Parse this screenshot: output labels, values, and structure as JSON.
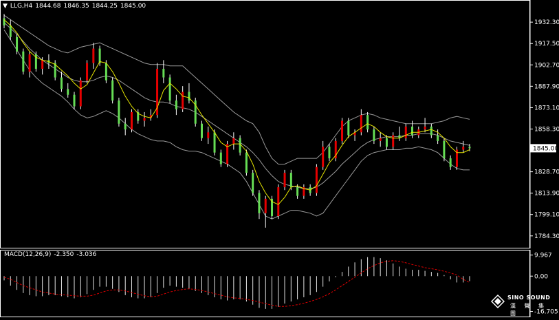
{
  "header": {
    "symbol": "LLG,H4",
    "open": "1844.68",
    "high": "1846.35",
    "low": "1844.25",
    "close": "1845.00"
  },
  "macd_header": {
    "label": "MACD(12,26,9)",
    "main": "-2.350",
    "signal": "-3.036"
  },
  "watermark": {
    "top_text": "SINO SOUND",
    "bottom_text": "漢 聲 集 團"
  },
  "colors": {
    "background": "#000000",
    "up_candle": "#e60000",
    "down_candle": "#66dd55",
    "wick": "#ffffff",
    "bands": "#9a9a9a",
    "moving_average": "#e6e600",
    "macd_histogram": "#e6e6e6",
    "macd_signal": "#dd0000",
    "price_marker_bg": "#ffffff"
  },
  "chart_data": [
    {
      "type": "candlestick",
      "title": "LLG,H4",
      "price_axis": {
        "min": 1778,
        "max": 1940,
        "ticks": [
          "1932.30",
          "1917.50",
          "1902.70",
          "1887.90",
          "1873.10",
          "1858.30",
          "1845.00",
          "1828.70",
          "1813.90",
          "1799.10",
          "1784.30"
        ],
        "current_price": "1845.00"
      },
      "overlays": [
        "Bollinger Bands",
        "Moving Average"
      ],
      "series": [
        {
          "name": "price",
          "candles": [
            [
              1935.0,
              1938.0,
              1928.0,
              1930.0
            ],
            [
              1930.0,
              1934.0,
              1920.0,
              1922.0
            ],
            [
              1922.0,
              1924.0,
              1910.0,
              1912.0
            ],
            [
              1912.0,
              1914.0,
              1896.0,
              1898.0
            ],
            [
              1898.0,
              1912.0,
              1894.0,
              1910.0
            ],
            [
              1910.0,
              1912.0,
              1898.0,
              1900.0
            ],
            [
              1900.0,
              1908.0,
              1896.0,
              1906.0
            ],
            [
              1906.0,
              1910.0,
              1900.0,
              1904.0
            ],
            [
              1904.0,
              1906.0,
              1892.0,
              1894.0
            ],
            [
              1894.0,
              1898.0,
              1884.0,
              1886.0
            ],
            [
              1886.0,
              1890.0,
              1880.0,
              1882.0
            ],
            [
              1882.0,
              1884.0,
              1872.0,
              1874.0
            ],
            [
              1874.0,
              1894.0,
              1872.0,
              1892.0
            ],
            [
              1892.0,
              1906.0,
              1890.0,
              1904.0
            ],
            [
              1904.0,
              1918.0,
              1900.0,
              1914.0
            ],
            [
              1914.0,
              1916.0,
              1902.0,
              1904.0
            ],
            [
              1904.0,
              1906.0,
              1890.0,
              1892.0
            ],
            [
              1892.0,
              1894.0,
              1876.0,
              1878.0
            ],
            [
              1878.0,
              1880.0,
              1860.0,
              1862.0
            ],
            [
              1862.0,
              1866.0,
              1854.0,
              1858.0
            ],
            [
              1858.0,
              1872.0,
              1856.0,
              1870.0
            ],
            [
              1870.0,
              1872.0,
              1862.0,
              1864.0
            ],
            [
              1864.0,
              1870.0,
              1860.0,
              1866.0
            ],
            [
              1866.0,
              1872.0,
              1864.0,
              1868.0
            ],
            [
              1868.0,
              1904.0,
              1866.0,
              1900.0
            ],
            [
              1900.0,
              1906.0,
              1890.0,
              1894.0
            ],
            [
              1894.0,
              1896.0,
              1876.0,
              1878.0
            ],
            [
              1878.0,
              1882.0,
              1868.0,
              1872.0
            ],
            [
              1872.0,
              1888.0,
              1870.0,
              1884.0
            ],
            [
              1884.0,
              1890.0,
              1876.0,
              1878.0
            ],
            [
              1878.0,
              1880.0,
              1860.0,
              1862.0
            ],
            [
              1862.0,
              1864.0,
              1850.0,
              1852.0
            ],
            [
              1852.0,
              1860.0,
              1848.0,
              1856.0
            ],
            [
              1856.0,
              1858.0,
              1840.0,
              1842.0
            ],
            [
              1842.0,
              1844.0,
              1832.0,
              1834.0
            ],
            [
              1834.0,
              1850.0,
              1832.0,
              1848.0
            ],
            [
              1848.0,
              1856.0,
              1844.0,
              1852.0
            ],
            [
              1852.0,
              1854.0,
              1840.0,
              1842.0
            ],
            [
              1842.0,
              1844.0,
              1826.0,
              1828.0
            ],
            [
              1828.0,
              1830.0,
              1812.0,
              1814.0
            ],
            [
              1814.0,
              1816.0,
              1796.0,
              1800.0
            ],
            [
              1800.0,
              1812.0,
              1790.0,
              1810.0
            ],
            [
              1810.0,
              1812.0,
              1796.0,
              1798.0
            ],
            [
              1798.0,
              1820.0,
              1796.0,
              1818.0
            ],
            [
              1818.0,
              1830.0,
              1816.0,
              1828.0
            ],
            [
              1828.0,
              1830.0,
              1816.0,
              1818.0
            ],
            [
              1818.0,
              1820.0,
              1810.0,
              1812.0
            ],
            [
              1812.0,
              1820.0,
              1810.0,
              1818.0
            ],
            [
              1818.0,
              1820.0,
              1812.0,
              1814.0
            ],
            [
              1814.0,
              1834.0,
              1812.0,
              1832.0
            ],
            [
              1832.0,
              1850.0,
              1830.0,
              1846.0
            ],
            [
              1846.0,
              1848.0,
              1836.0,
              1838.0
            ],
            [
              1838.0,
              1852.0,
              1836.0,
              1850.0
            ],
            [
              1850.0,
              1866.0,
              1848.0,
              1864.0
            ],
            [
              1864.0,
              1866.0,
              1852.0,
              1854.0
            ],
            [
              1854.0,
              1858.0,
              1850.0,
              1856.0
            ],
            [
              1856.0,
              1872.0,
              1854.0,
              1868.0
            ],
            [
              1868.0,
              1870.0,
              1856.0,
              1858.0
            ],
            [
              1858.0,
              1860.0,
              1848.0,
              1850.0
            ],
            [
              1850.0,
              1856.0,
              1846.0,
              1852.0
            ],
            [
              1852.0,
              1854.0,
              1844.0,
              1846.0
            ],
            [
              1846.0,
              1856.0,
              1844.0,
              1854.0
            ],
            [
              1854.0,
              1860.0,
              1850.0,
              1852.0
            ],
            [
              1852.0,
              1862.0,
              1850.0,
              1860.0
            ],
            [
              1860.0,
              1864.0,
              1852.0,
              1854.0
            ],
            [
              1854.0,
              1860.0,
              1852.0,
              1858.0
            ],
            [
              1858.0,
              1866.0,
              1856.0,
              1860.0
            ],
            [
              1860.0,
              1862.0,
              1852.0,
              1854.0
            ],
            [
              1854.0,
              1858.0,
              1848.0,
              1850.0
            ],
            [
              1850.0,
              1852.0,
              1836.0,
              1838.0
            ],
            [
              1838.0,
              1840.0,
              1830.0,
              1832.0
            ],
            [
              1832.0,
              1846.0,
              1830.0,
              1844.0
            ],
            [
              1844.0,
              1850.0,
              1842.0,
              1846.0
            ],
            [
              1846.0,
              1848.0,
              1843.0,
              1845.0
            ]
          ],
          "bb_upper": [
            1937.0,
            1934.0,
            1931.0,
            1928.0,
            1925.0,
            1922.0,
            1919.0,
            1916.0,
            1914.0,
            1912.0,
            1911.0,
            1913.0,
            1915.0,
            1916.0,
            1917.0,
            1918.0,
            1916.0,
            1914.0,
            1912.0,
            1910.0,
            1908.0,
            1906.0,
            1904.0,
            1903.0,
            1903.0,
            1903.0,
            1902.0,
            1902.0,
            1902.0,
            1898.0,
            1894.0,
            1890.0,
            1886.0,
            1882.0,
            1878.0,
            1874.0,
            1870.0,
            1867.0,
            1864.0,
            1862.0,
            1856.0,
            1846.0,
            1838.0,
            1834.0,
            1834.0,
            1836.0,
            1838.0,
            1838.0,
            1838.0,
            1838.0,
            1842.0,
            1848.0,
            1854.0,
            1860.0,
            1864.0,
            1866.0,
            1868.0,
            1869.0,
            1868.0,
            1866.0,
            1865.0,
            1864.0,
            1863.0,
            1862.0,
            1862.0,
            1862.0,
            1862.0,
            1862.0,
            1863.0,
            1864.0,
            1866.0,
            1867.0,
            1866.0,
            1865.0
          ],
          "bb_middle": [
            1932.0,
            1928.0,
            1924.0,
            1919.0,
            1914.0,
            1910.0,
            1906.0,
            1903.0,
            1900.0,
            1897.0,
            1894.0,
            1892.0,
            1891.0,
            1891.0,
            1892.0,
            1894.0,
            1895.0,
            1894.0,
            1892.0,
            1889.0,
            1886.0,
            1883.0,
            1880.0,
            1878.0,
            1877.0,
            1877.0,
            1876.0,
            1874.0,
            1873.0,
            1872.0,
            1870.0,
            1867.0,
            1864.0,
            1861.0,
            1858.0,
            1855.0,
            1852.0,
            1849.0,
            1846.0,
            1842.0,
            1837.0,
            1831.0,
            1826.0,
            1822.0,
            1820.0,
            1819.0,
            1818.0,
            1817.0,
            1817.0,
            1818.0,
            1821.0,
            1825.0,
            1829.0,
            1834.0,
            1838.0,
            1842.0,
            1846.0,
            1849.0,
            1851.0,
            1852.0,
            1853.0,
            1853.0,
            1853.0,
            1854.0,
            1854.0,
            1855.0,
            1855.0,
            1855.0,
            1854.0,
            1852.0,
            1850.0,
            1849.0,
            1848.0,
            1847.0
          ],
          "bb_lower": [
            1927.0,
            1920.0,
            1913.0,
            1906.0,
            1899.0,
            1894.0,
            1890.0,
            1887.0,
            1884.0,
            1881.0,
            1877.0,
            1872.0,
            1868.0,
            1866.0,
            1867.0,
            1869.0,
            1871.0,
            1869.0,
            1866.0,
            1862.0,
            1858.0,
            1855.0,
            1853.0,
            1851.0,
            1850.0,
            1850.0,
            1849.0,
            1846.0,
            1844.0,
            1843.0,
            1843.0,
            1842.0,
            1840.0,
            1838.0,
            1836.0,
            1834.0,
            1831.0,
            1828.0,
            1822.0,
            1814.0,
            1806.0,
            1798.0,
            1796.0,
            1798.0,
            1800.0,
            1802.0,
            1802.0,
            1801.0,
            1800.0,
            1798.0,
            1800.0,
            1806.0,
            1812.0,
            1818.0,
            1824.0,
            1830.0,
            1836.0,
            1840.0,
            1842.0,
            1843.0,
            1844.0,
            1844.0,
            1844.0,
            1845.0,
            1845.0,
            1846.0,
            1845.0,
            1844.0,
            1842.0,
            1838.0,
            1834.0,
            1831.0,
            1830.0,
            1830.0
          ],
          "ma": [
            1934.0,
            1930.0,
            1925.0,
            1918.0,
            1912.0,
            1908.0,
            1906.0,
            1905.0,
            1903.0,
            1899.0,
            1895.0,
            1890.0,
            1886.0,
            1889.0,
            1897.0,
            1905.0,
            1904.0,
            1898.0,
            1890.0,
            1881.0,
            1874.0,
            1869.0,
            1867.0,
            1866.0,
            1873.0,
            1885.0,
            1890.0,
            1886.0,
            1881.0,
            1880.0,
            1875.0,
            1868.0,
            1862.0,
            1856.0,
            1849.0,
            1846.0,
            1848.0,
            1848.0,
            1843.0,
            1834.0,
            1822.0,
            1814.0,
            1808.0,
            1806.0,
            1811.0,
            1818.0,
            1819.0,
            1817.0,
            1816.0,
            1819.0,
            1827.0,
            1835.0,
            1840.0,
            1847.0,
            1853.0,
            1856.0,
            1859.0,
            1862.0,
            1860.0,
            1856.0,
            1853.0,
            1852.0,
            1852.0,
            1854.0,
            1856.0,
            1856.0,
            1857.0,
            1858.0,
            1856.0,
            1852.0,
            1846.0,
            1842.0,
            1842.0,
            1844.0
          ]
        }
      ]
    },
    {
      "type": "bar",
      "title": "MACD(12,26,9)",
      "axis": {
        "min": -17.5,
        "max": 10.5,
        "ticks": [
          "9.967",
          "0.00",
          "-16.705"
        ]
      },
      "series": [
        {
          "name": "main",
          "values": [
            -2.0,
            -4.5,
            -6.5,
            -8.0,
            -9.0,
            -9.5,
            -9.5,
            -9.0,
            -9.0,
            -9.5,
            -10.0,
            -10.5,
            -10.0,
            -8.5,
            -6.5,
            -5.0,
            -5.0,
            -6.0,
            -7.5,
            -9.0,
            -10.0,
            -10.5,
            -10.5,
            -10.0,
            -8.0,
            -5.5,
            -4.5,
            -5.0,
            -5.5,
            -6.0,
            -7.0,
            -8.0,
            -9.0,
            -10.0,
            -11.0,
            -11.5,
            -11.0,
            -11.0,
            -12.0,
            -13.5,
            -15.0,
            -15.5,
            -15.5,
            -14.5,
            -13.0,
            -12.0,
            -11.0,
            -10.0,
            -9.0,
            -7.5,
            -5.0,
            -2.5,
            -0.5,
            2.0,
            4.5,
            6.5,
            8.0,
            9.0,
            9.0,
            8.5,
            7.5,
            6.0,
            4.5,
            3.5,
            3.0,
            3.0,
            2.5,
            2.0,
            1.5,
            0.5,
            -1.5,
            -3.0,
            -3.0,
            -2.35
          ]
        },
        {
          "name": "signal",
          "values": [
            -0.5,
            -1.5,
            -3.0,
            -4.5,
            -5.5,
            -6.5,
            -7.5,
            -8.0,
            -8.5,
            -8.8,
            -9.0,
            -9.3,
            -9.5,
            -9.5,
            -9.0,
            -8.0,
            -7.0,
            -6.5,
            -6.5,
            -7.0,
            -7.8,
            -8.5,
            -9.3,
            -9.8,
            -9.5,
            -8.5,
            -7.5,
            -6.8,
            -6.3,
            -6.0,
            -6.3,
            -6.8,
            -7.5,
            -8.3,
            -9.0,
            -9.8,
            -10.3,
            -10.5,
            -11.0,
            -11.5,
            -12.3,
            -13.0,
            -13.8,
            -14.3,
            -14.3,
            -14.0,
            -13.5,
            -12.8,
            -12.0,
            -11.0,
            -9.8,
            -8.3,
            -6.5,
            -4.5,
            -2.5,
            -0.5,
            1.5,
            3.5,
            5.0,
            6.3,
            7.0,
            7.3,
            7.0,
            6.3,
            5.5,
            4.8,
            4.0,
            3.5,
            3.0,
            2.3,
            1.5,
            0.5,
            -1.5,
            -3.036
          ]
        }
      ]
    }
  ]
}
